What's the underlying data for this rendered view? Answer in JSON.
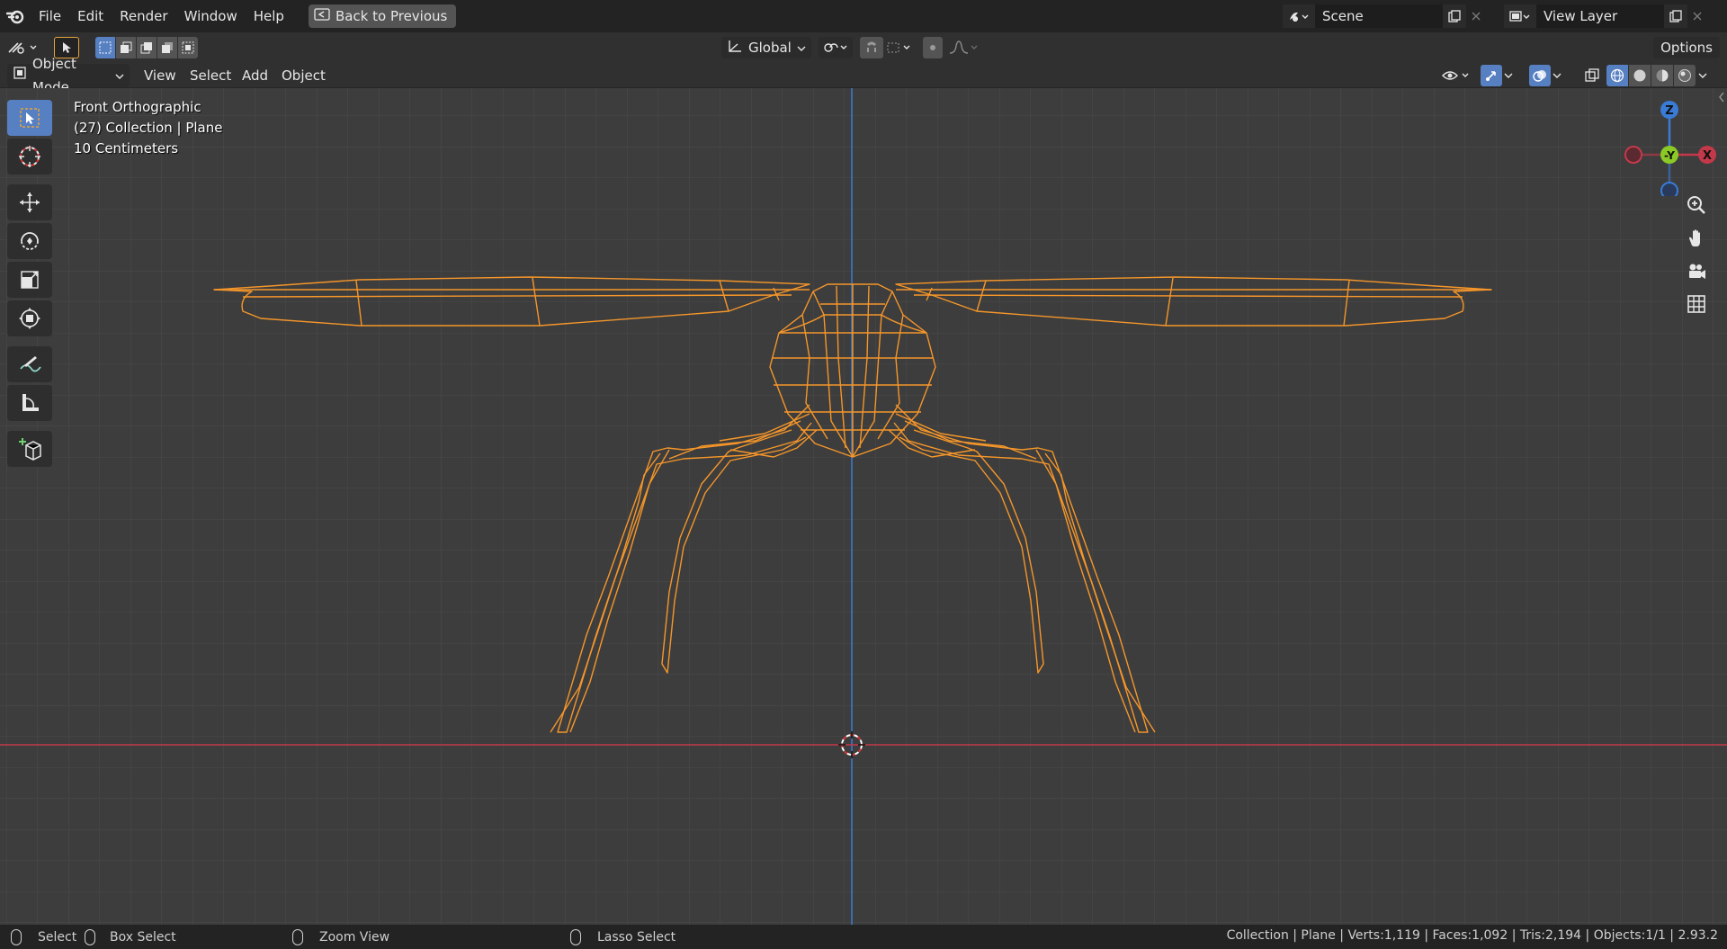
{
  "topbar": {
    "menu": [
      "File",
      "Edit",
      "Render",
      "Window",
      "Help"
    ],
    "back_button": "Back to Previous",
    "scene": "Scene",
    "view_layer": "View Layer"
  },
  "toolrow": {
    "orientation": "Global",
    "options": "Options"
  },
  "header": {
    "mode": "Object Mode",
    "menus": [
      "View",
      "Select",
      "Add",
      "Object"
    ]
  },
  "viewport": {
    "view_name": "Front Orthographic",
    "collection": "(27) Collection | Plane",
    "scale": "10 Centimeters",
    "gizmo": {
      "z": "Z",
      "y": "-Y",
      "x": "X"
    }
  },
  "statusbar": {
    "select": "Select",
    "box_select": "Box Select",
    "zoom_view": "Zoom View",
    "lasso_select": "Lasso Select",
    "stats": "Collection | Plane | Verts:1,119 | Faces:1,092 | Tris:2,194 | Objects:1/1 | 2.93.2"
  },
  "colors": {
    "accent": "#5680c2",
    "wire": "#f5962a",
    "axis_x": "#c3394a",
    "axis_y": "#3a7bd5",
    "gizmo_y": "#8ac926"
  }
}
